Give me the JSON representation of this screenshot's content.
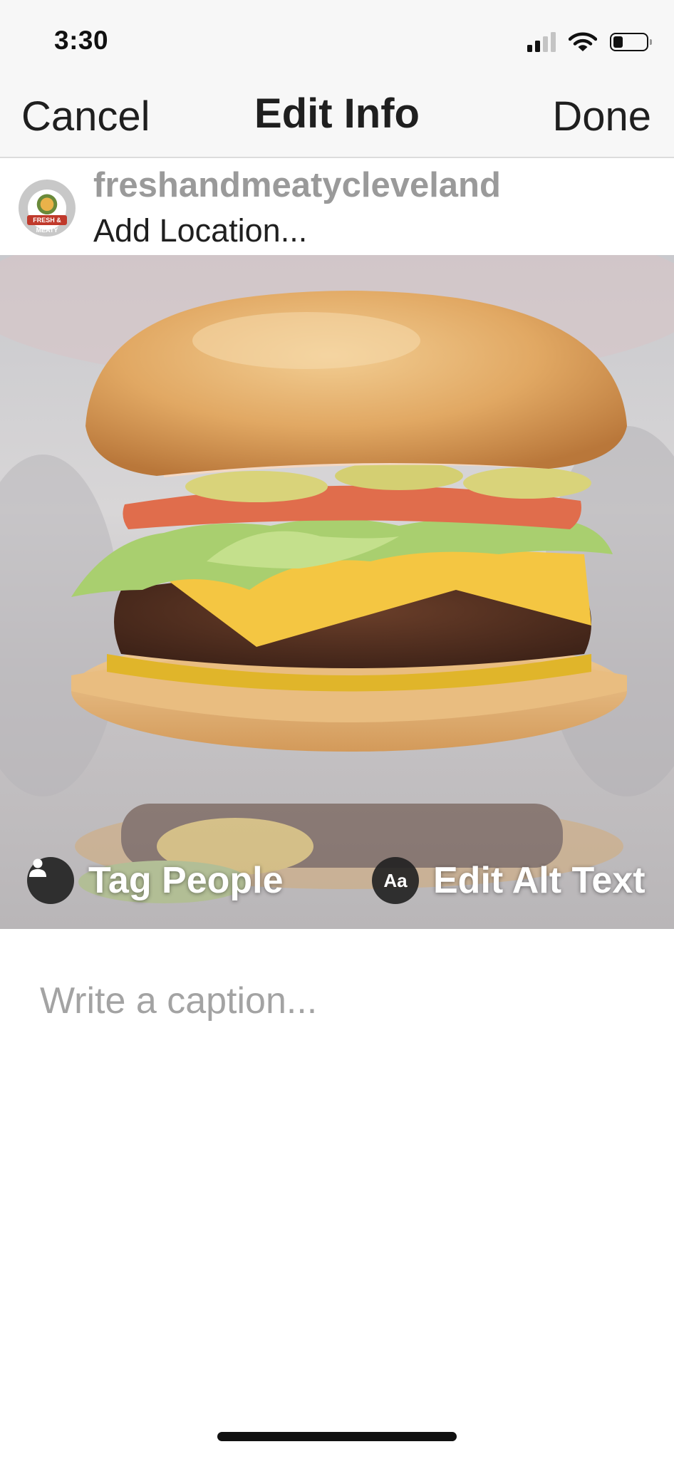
{
  "status_bar": {
    "time": "3:30",
    "icons": [
      "cellular-signal-icon",
      "wifi-icon",
      "battery-icon"
    ]
  },
  "nav": {
    "cancel_label": "Cancel",
    "title": "Edit Info",
    "done_label": "Done"
  },
  "account": {
    "username": "freshandmeatycleveland",
    "location_placeholder": "Add Location...",
    "avatar_logo_text": "FRESH & MEATY BURGERS"
  },
  "photo": {
    "subject": "cheeseburger",
    "tag_people_label": "Tag People",
    "alt_text_label": "Edit Alt Text",
    "alt_text_icon_glyph": "Aa"
  },
  "caption": {
    "placeholder": "Write a caption..."
  },
  "colors": {
    "bar_background": "#f7f7f7",
    "text_primary": "#1f1f1f",
    "text_muted": "#9a9a9a",
    "placeholder": "#a3a3a3"
  }
}
